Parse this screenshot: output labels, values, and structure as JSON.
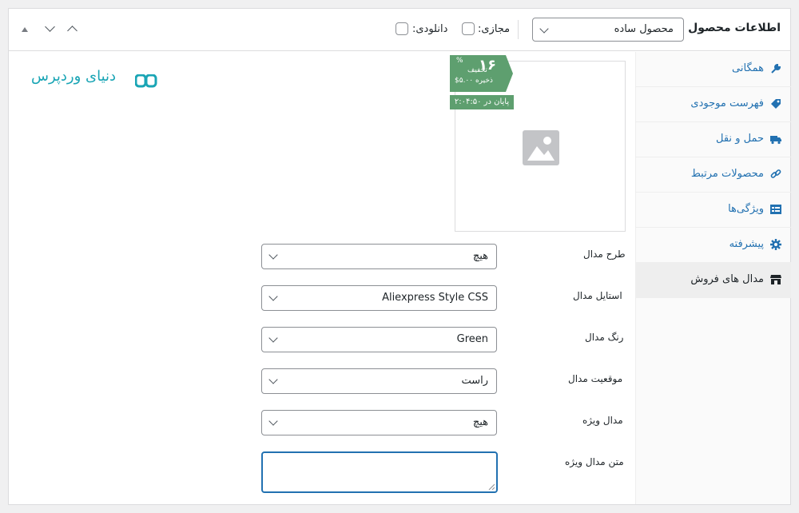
{
  "header": {
    "title": "اطلاعات محصول —",
    "product_type": {
      "selected": "محصول ساده"
    },
    "virtual_label": "مجازی:",
    "downloadable_label": "دانلودی:"
  },
  "logo": {
    "text": "دنیای وردپرس"
  },
  "sidebar": {
    "items": [
      {
        "label": "همگانی",
        "icon": "wrench-icon"
      },
      {
        "label": "فهرست موجودی",
        "icon": "tag-icon"
      },
      {
        "label": "حمل و نقل",
        "icon": "truck-icon"
      },
      {
        "label": "محصولات مرتبط",
        "icon": "link-icon"
      },
      {
        "label": "ویژگی‌ها",
        "icon": "list-icon"
      },
      {
        "label": "پیشرفته",
        "icon": "gear-icon"
      },
      {
        "label": "مدال های فروش",
        "icon": "store-icon",
        "active": true
      }
    ]
  },
  "preview": {
    "badge_number": "۱۶",
    "badge_percent": "%",
    "badge_off": "تخفیف",
    "badge_save": "ذخیره ۵.۰۰$",
    "timer": "پایان در ۲:۰۴:۵۰"
  },
  "form": {
    "fields": [
      {
        "label": "طرح مدال",
        "value": "هیچ"
      },
      {
        "label": "استایل مدال",
        "value": "Aliexpress Style CSS"
      },
      {
        "label": "رنگ مدال",
        "value": "Green"
      },
      {
        "label": "موقعیت مدال",
        "value": "راست"
      },
      {
        "label": "مدال ویژه",
        "value": "هیچ"
      }
    ],
    "special_text_label": "متن مدال ویژه",
    "special_text_value": ""
  },
  "colors": {
    "accent": "#2271b1",
    "badge": "#5e9f6f",
    "logo": "#1aa5b5"
  }
}
